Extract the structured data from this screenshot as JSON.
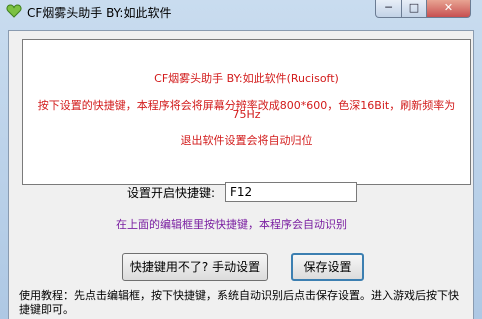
{
  "window": {
    "title": "CF烟雾头助手  BY:如此软件",
    "minimize_glyph": "─",
    "maximize_glyph": "□",
    "close_glyph": "✕"
  },
  "info": {
    "line1": "CF烟雾头助手   BY:如此软件(Rucisoft)",
    "line2": "按下设置的快捷键，本程序将会将屏幕分辨率改成800*600，色深16Bit，刷新频率为",
    "line3": "75Hz",
    "line4": "退出软件设置会将自动归位"
  },
  "hotkey": {
    "label": "设置开启快捷键:",
    "value": "F12",
    "hint": "在上面的编辑框里按快捷键，本程序会自动识别"
  },
  "buttons": {
    "manual": "快捷键用不了? 手动设置",
    "save": "保存设置"
  },
  "tutorial": {
    "text": "使用教程：先点击编辑框，按下快捷键，系统自动识别后点击保存设置。进入游戏后按下快捷键即可。"
  },
  "colors": {
    "info_text": "#d21b1b",
    "hint_text": "#7a1ea1",
    "accent": "#3c7fb1"
  },
  "icons": {
    "app": "heart-icon"
  }
}
